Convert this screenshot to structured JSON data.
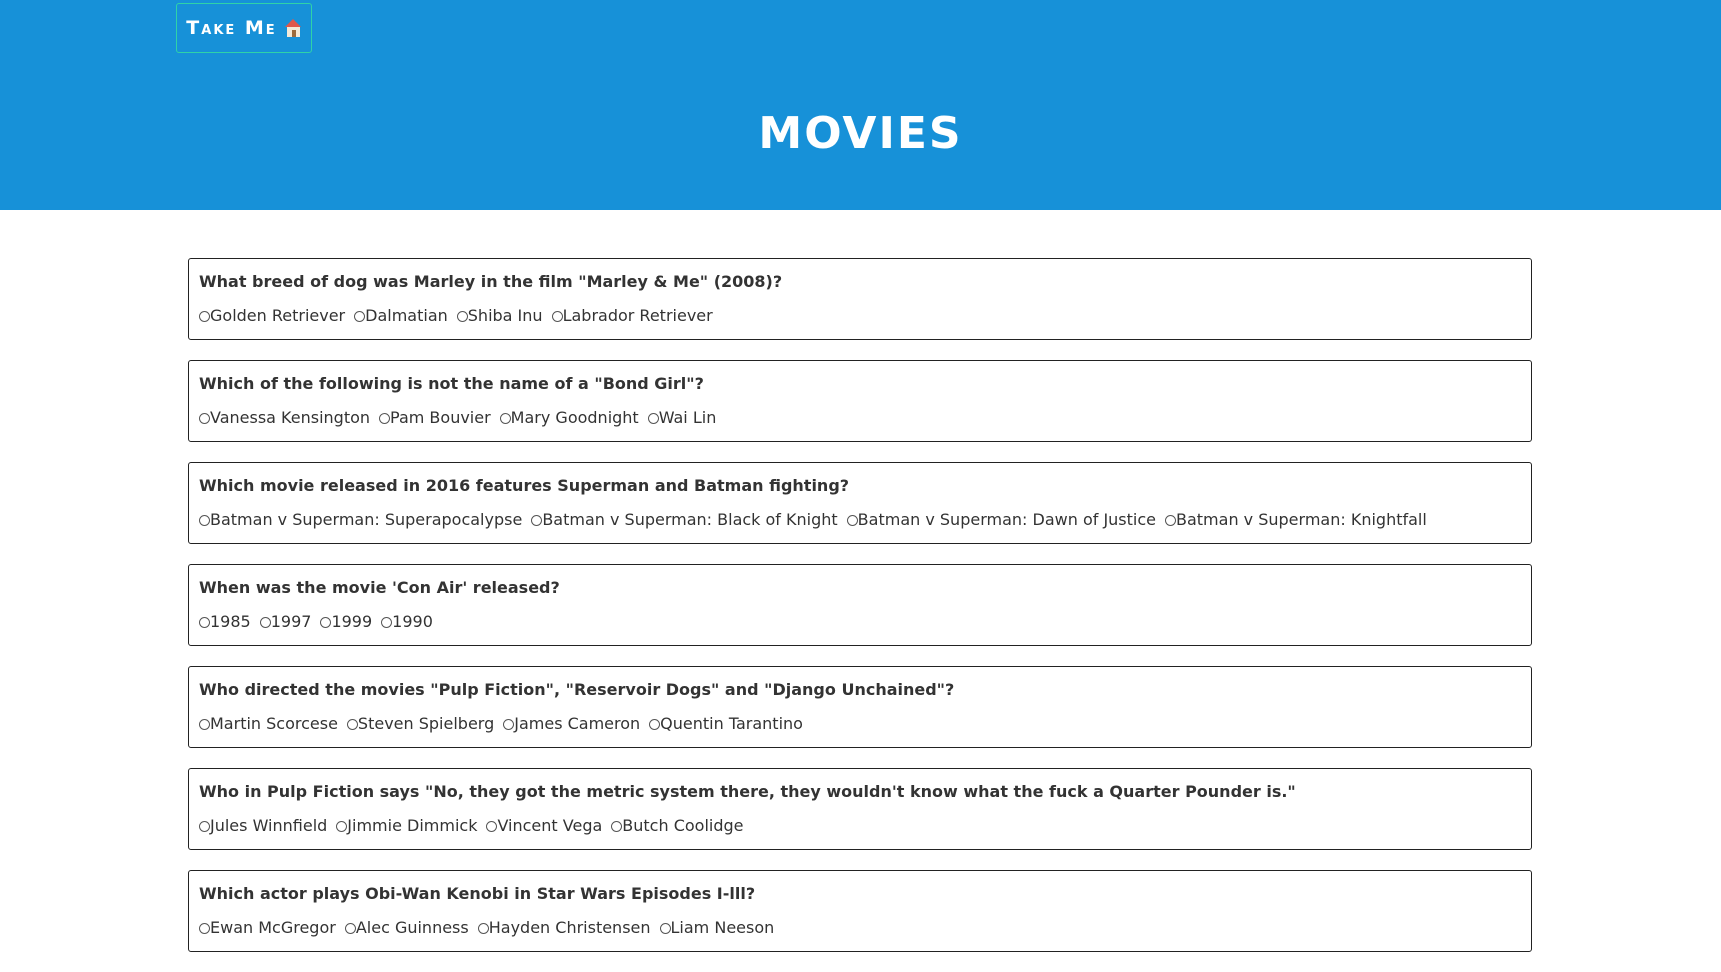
{
  "header": {
    "home_button": {
      "label": "Take Me",
      "icon": "house-icon"
    },
    "title": "MOVIES"
  },
  "questions": [
    {
      "text": "What breed of dog was Marley in the film \"Marley & Me\" (2008)?",
      "answers": [
        "Golden Retriever",
        "Dalmatian",
        "Shiba Inu",
        "Labrador Retriever"
      ]
    },
    {
      "text": "Which of the following is not the name of a \"Bond Girl\"?",
      "answers": [
        "Vanessa Kensington",
        "Pam Bouvier",
        "Mary Goodnight",
        "Wai Lin"
      ]
    },
    {
      "text": "Which movie released in 2016 features Superman and Batman fighting?",
      "answers": [
        "Batman v Superman: Superapocalypse",
        "Batman v Superman: Black of Knight",
        "Batman v Superman: Dawn of Justice",
        "Batman v Superman: Knightfall"
      ]
    },
    {
      "text": "When was the movie 'Con Air' released?",
      "answers": [
        "1985",
        "1997",
        "1999",
        "1990"
      ]
    },
    {
      "text": "Who directed the movies \"Pulp Fiction\", \"Reservoir Dogs\" and \"Django Unchained\"?",
      "answers": [
        "Martin Scorcese",
        "Steven Spielberg",
        "James Cameron",
        "Quentin Tarantino"
      ]
    },
    {
      "text": "Who in Pulp Fiction says \"No, they got the metric system there, they wouldn't know what the fuck a Quarter Pounder is.\"",
      "answers": [
        "Jules Winnfield",
        "Jimmie Dimmick",
        "Vincent Vega",
        "Butch Coolidge"
      ]
    },
    {
      "text": "Which actor plays Obi-Wan Kenobi in Star Wars Episodes I-lll?",
      "answers": [
        "Ewan McGregor",
        "Alec Guinness",
        "Hayden Christensen",
        "Liam Neeson"
      ]
    }
  ],
  "colors": {
    "header_bg": "#1791d8",
    "button_border": "#2fd3a8",
    "text": "#333333"
  }
}
